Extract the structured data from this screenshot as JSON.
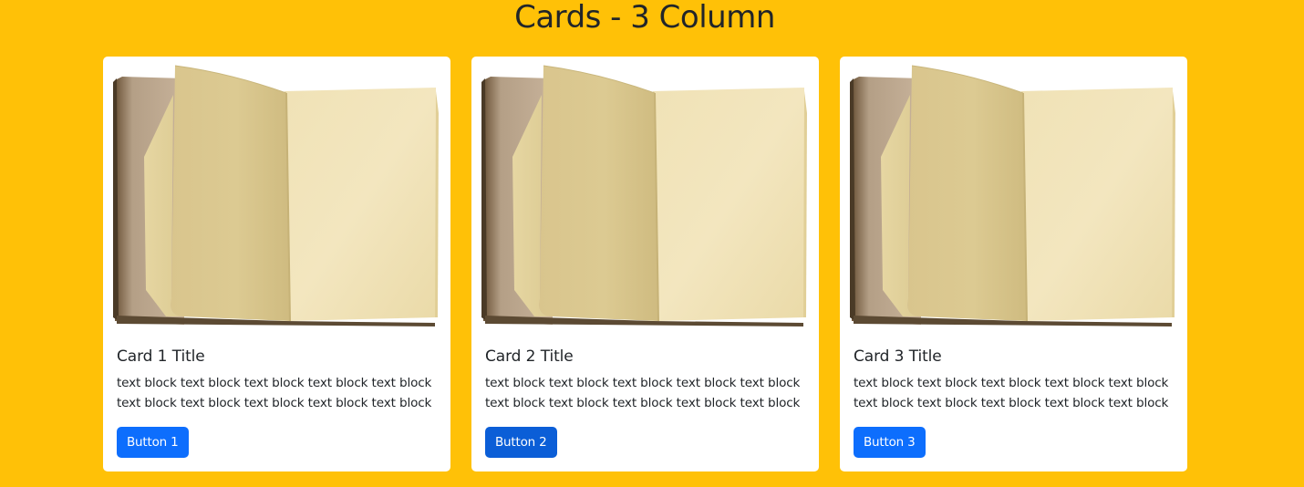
{
  "page": {
    "title": "Cards - 3 Column"
  },
  "colors": {
    "background": "#FFC107",
    "card": "#FFFFFF",
    "button": "#0D6EFD",
    "button_pressed": "#0B5ED7",
    "text": "#212529"
  },
  "cards": [
    {
      "image_icon": "open-book-image",
      "title": "Card 1 Title",
      "text_lines": [
        "text block text block text block text block text block",
        "text block text block text block text block text block"
      ],
      "button_label": "Button 1"
    },
    {
      "image_icon": "open-book-image",
      "title": "Card 2 Title",
      "text_lines": [
        "text block text block text block text block text block",
        "text block text block text block text block text block"
      ],
      "button_label": "Button 2"
    },
    {
      "image_icon": "open-book-image",
      "title": "Card 3 Title",
      "text_lines": [
        "text block text block text block text block text block",
        "text block text block text block text block text block"
      ],
      "button_label": "Button 3"
    }
  ]
}
